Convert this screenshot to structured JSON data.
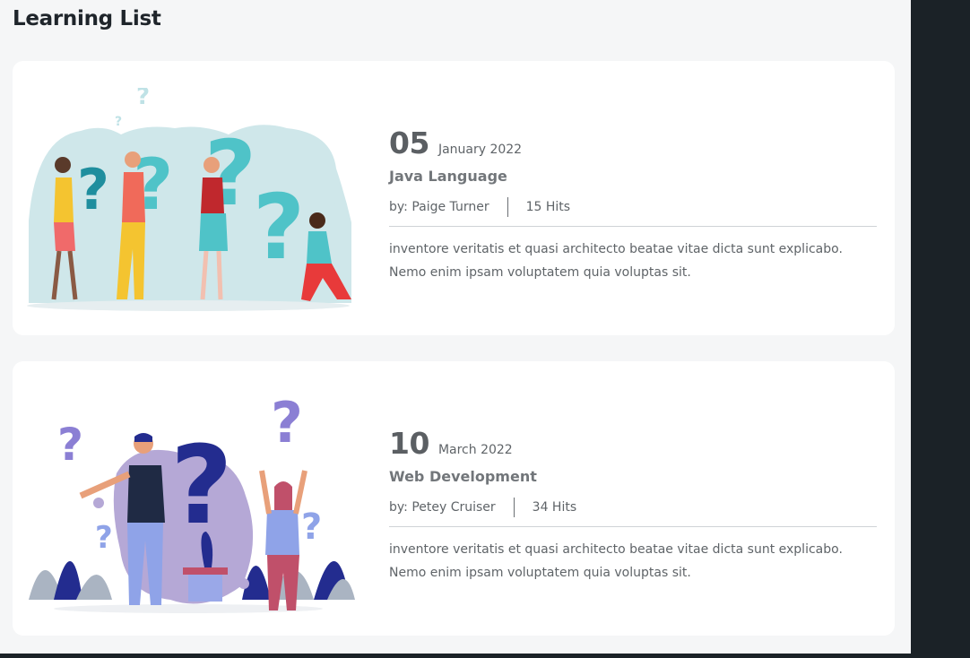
{
  "page": {
    "title": "Learning List"
  },
  "posts": [
    {
      "day": "05",
      "month_year": "January 2022",
      "title": "Java Language",
      "author": "by: Paige Turner",
      "hits": "15 Hits",
      "description": "inventore veritatis et quasi architecto beatae vitae dicta sunt explicabo. Nemo enim ipsam voluptatem quia voluptas sit.",
      "illustration": "people-with-question-marks-teal"
    },
    {
      "day": "10",
      "month_year": "March 2022",
      "title": "Web Development",
      "author": "by: Petey Cruiser",
      "hits": "34 Hits",
      "description": "inventore veritatis et quasi architecto beatae vitae dicta sunt explicabo. Nemo enim ipsam voluptatem quia voluptas sit.",
      "illustration": "people-with-question-marks-purple"
    }
  ],
  "colors": {
    "background": "#f5f6f7",
    "sidebar_dark": "#1b2227",
    "teal_accent": "#4fc3c8",
    "purple_accent": "#8b7fd4",
    "navy_accent": "#232c8f"
  }
}
